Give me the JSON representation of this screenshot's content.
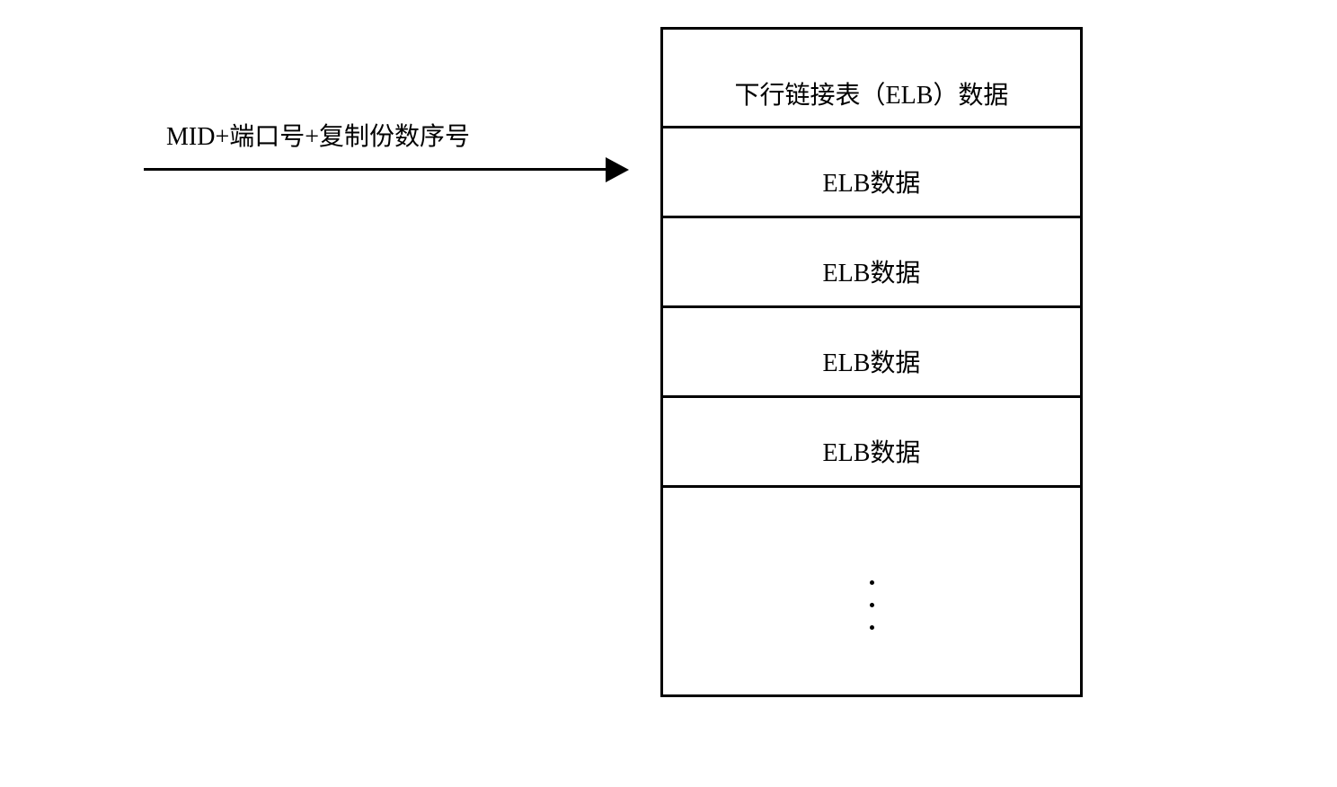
{
  "label": "MID+端口号+复制份数序号",
  "table": {
    "rows": [
      "下行链接表（ELB）数据",
      "ELB数据",
      "ELB数据",
      "ELB数据",
      "ELB数据"
    ]
  }
}
